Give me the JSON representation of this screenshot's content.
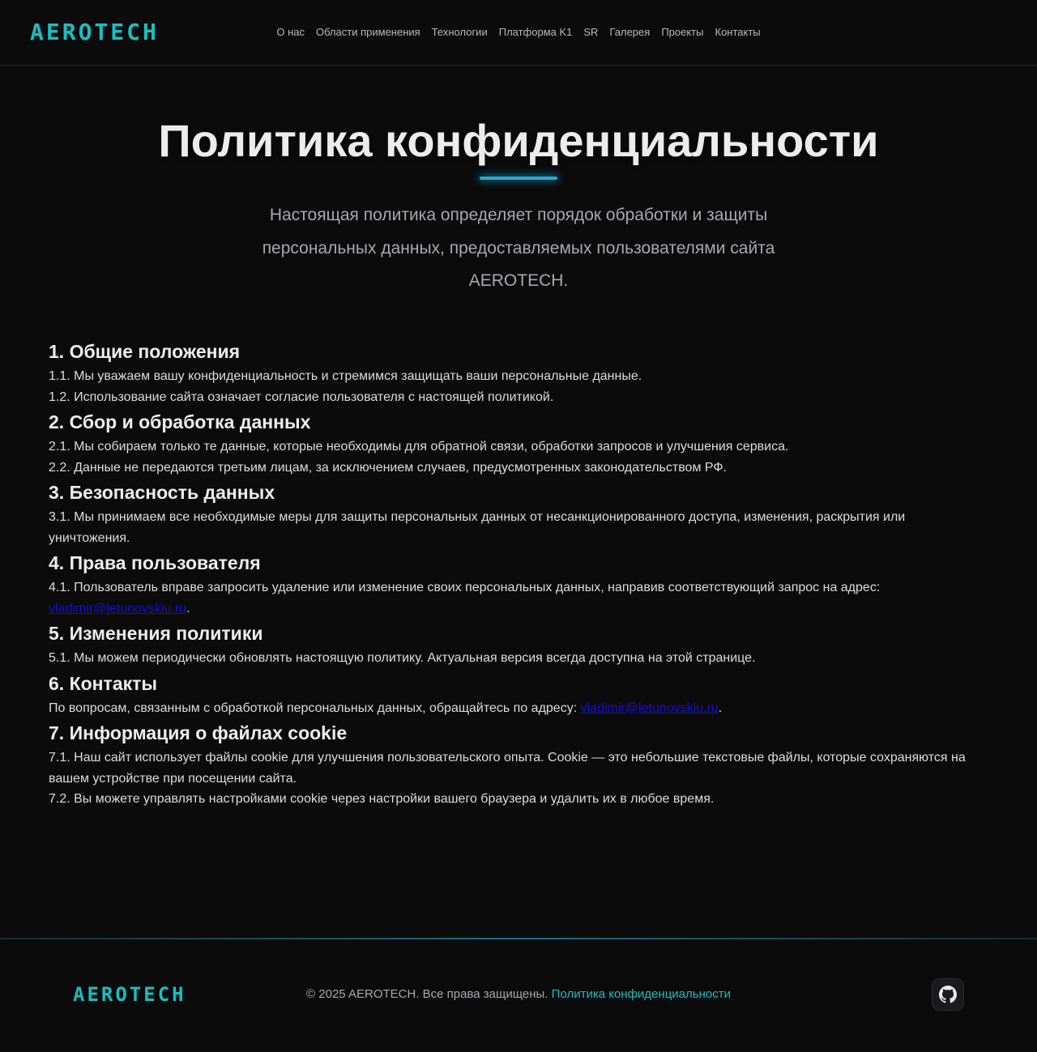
{
  "header": {
    "logo": "AEROTECH",
    "nav": [
      {
        "label": "О нас"
      },
      {
        "label": "Области применения"
      },
      {
        "label": "Технологии"
      },
      {
        "label": "Платформа K1"
      },
      {
        "label": "SR"
      },
      {
        "label": "Галерея"
      },
      {
        "label": "Проекты"
      },
      {
        "label": "Контакты"
      }
    ]
  },
  "hero": {
    "title": "Политика конфиденциальности",
    "lead": "Настоящая политика определяет порядок обработки и защиты персональных данных, предоставляемых пользователями сайта AEROTECH."
  },
  "sections": [
    {
      "heading": "1. Общие положения",
      "paragraphs": [
        "1.1. Мы уважаем вашу конфиденциальность и стремимся защищать ваши персональные данные.",
        "1.2. Использование сайта означает согласие пользователя с настоящей политикой."
      ]
    },
    {
      "heading": "2. Сбор и обработка данных",
      "paragraphs": [
        "2.1. Мы собираем только те данные, которые необходимы для обратной связи, обработки запросов и улучшения сервиса.",
        "2.2. Данные не передаются третьим лицам, за исключением случаев, предусмотренных законодательством РФ."
      ]
    },
    {
      "heading": "3. Безопасность данных",
      "paragraphs": [
        "3.1. Мы принимаем все необходимые меры для защиты персональных данных от несанкционированного доступа, изменения, раскрытия или уничтожения."
      ]
    },
    {
      "heading": "4. Права пользователя",
      "p1_text": "4.1. Пользователь вправе запросить удаление или изменение своих персональных данных, направив соответствующий запрос на адрес:",
      "email": "vladimir@letunovskiu.ru",
      "suffix": "."
    },
    {
      "heading": "5. Изменения политики",
      "paragraphs": [
        "5.1. Мы можем периодически обновлять настоящую политику. Актуальная версия всегда доступна на этой странице."
      ]
    },
    {
      "heading": "6. Контакты",
      "p1_text": "По вопросам, связанным с обработкой персональных данных, обращайтесь по адресу:",
      "email": "vladimir@letunovskiu.ru",
      "suffix": "."
    },
    {
      "heading": "7. Информация о файлах cookie",
      "paragraphs": [
        "7.1. Наш сайт использует файлы cookie для улучшения пользовательского опыта. Cookie — это небольшие текстовые файлы, которые сохраняются на вашем устройстве при посещении сайта.",
        "7.2. Вы можете управлять настройками cookie через настройки вашего браузера и удалить их в любое время."
      ]
    }
  ],
  "footer": {
    "logo": "AEROTECH",
    "copyright": "© 2025 AEROTECH. Все права защищены.",
    "privacy_link": "Политика конфиденциальности",
    "github_icon": "github-icon"
  },
  "colors": {
    "accent": "#16c0c0",
    "background": "#0b0b0c",
    "link": "#1a0dd1"
  }
}
